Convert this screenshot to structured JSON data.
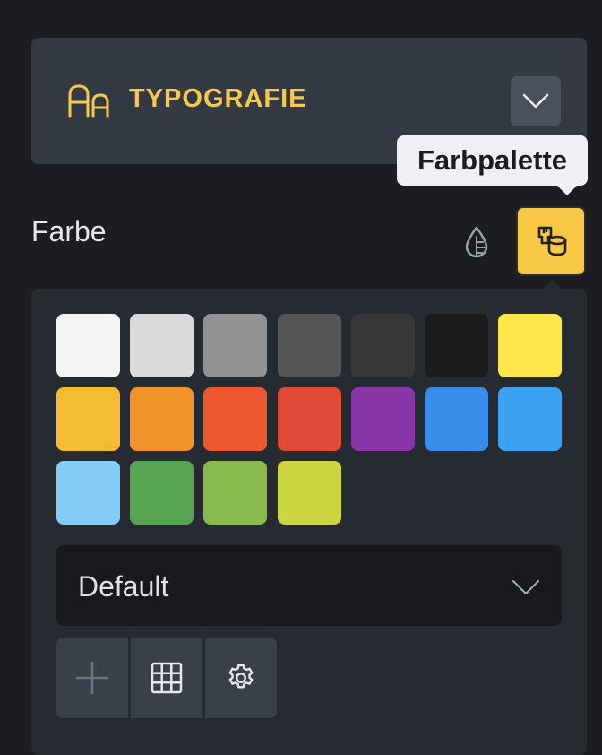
{
  "section": {
    "title": "TYPOGRAFIE",
    "icon": "typography-icon",
    "collapse_icon": "chevron-down-icon"
  },
  "tooltip": {
    "text": "Farbpalette"
  },
  "color_field": {
    "label": "Farbe",
    "buttons": [
      {
        "name": "color-drop-button",
        "icon": "color-drop-icon"
      },
      {
        "name": "color-palette-button",
        "icon": "paint-bucket-icon",
        "active": true
      }
    ]
  },
  "palette": {
    "swatches": [
      "#f4f4f4",
      "#dadada",
      "#929292",
      "#555555",
      "#383838",
      "#1b1b1b",
      "#fee74a",
      "#f6bc31",
      "#f2922b",
      "#ef5731",
      "#e24a38",
      "#8935a8",
      "#3a8ceb",
      "#3aa2f0",
      "#84cdf9",
      "#56a550",
      "#8ab94d",
      "#ccd440"
    ],
    "select": {
      "value": "Default",
      "icon": "chevron-down-icon"
    },
    "tools": [
      {
        "name": "add-color-button",
        "icon": "plus-icon"
      },
      {
        "name": "grid-view-button",
        "icon": "grid-icon"
      },
      {
        "name": "settings-button",
        "icon": "gear-icon"
      }
    ]
  },
  "colors": {
    "background": "#1b1d21",
    "accent": "#f7c94b",
    "header_bg": "#343a44",
    "panel_bg": "#262b32"
  }
}
